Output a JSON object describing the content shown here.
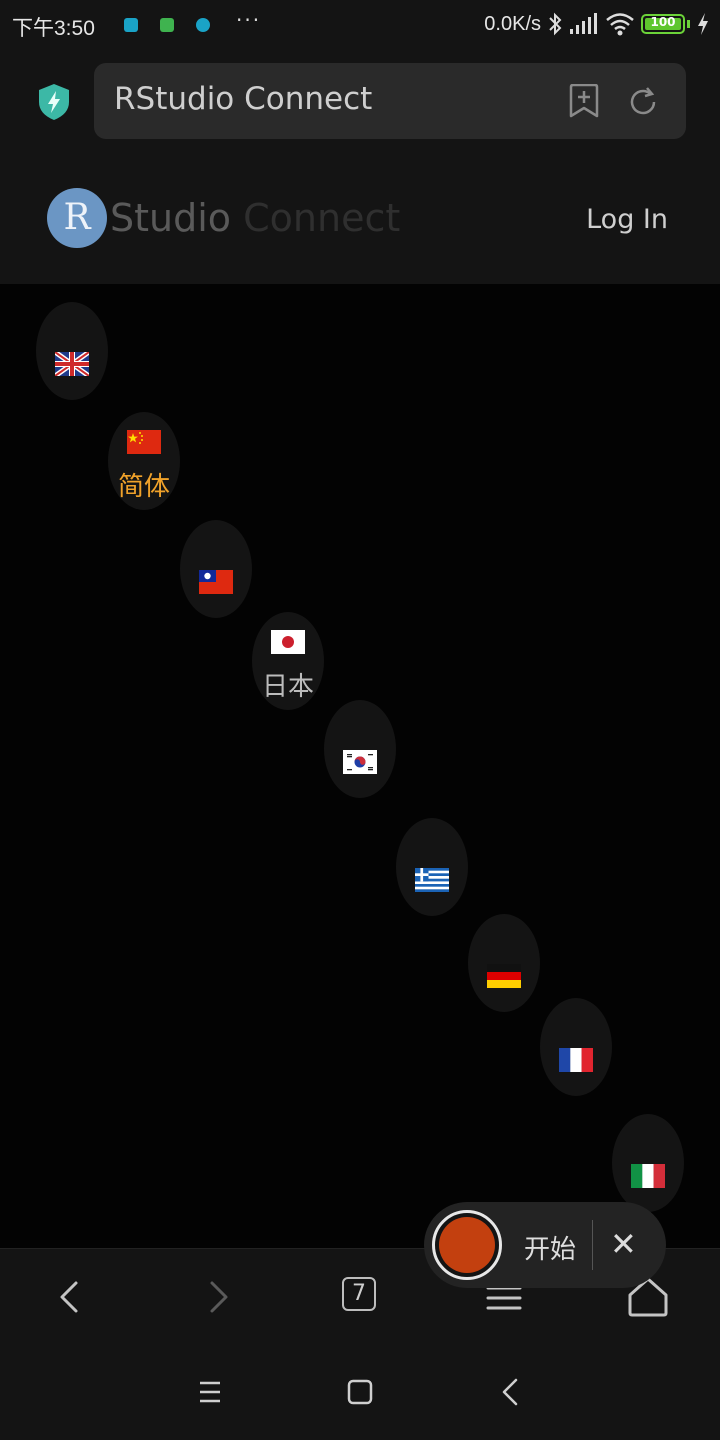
{
  "status_bar": {
    "time": "下午3:50",
    "network_speed": "0.0K/s",
    "battery_percent": "100",
    "battery_level": 1.0,
    "more_indicator": "···",
    "notification_colors": [
      "#1aa3c7",
      "#3fb34f",
      "#1aa3c7"
    ]
  },
  "browser": {
    "url_title": "RStudio Connect",
    "shield_color": "#3cb8a6",
    "tab_count": "7"
  },
  "header": {
    "logo_letter": "R",
    "logo_studio": "Studio",
    "logo_connect": " Connect",
    "login_label": "Log In"
  },
  "languages": [
    {
      "flag": "uk",
      "label": "",
      "active": false
    },
    {
      "flag": "china",
      "label": "简体",
      "active": true
    },
    {
      "flag": "taiwan",
      "label": "",
      "active": false
    },
    {
      "flag": "japan",
      "label": "日本",
      "active": false
    },
    {
      "flag": "korea",
      "label": "",
      "active": false
    },
    {
      "flag": "greece",
      "label": "",
      "active": false
    },
    {
      "flag": "germany",
      "label": "",
      "active": false
    },
    {
      "flag": "france",
      "label": "",
      "active": false
    },
    {
      "flag": "italy",
      "label": "",
      "active": false
    }
  ],
  "recorder": {
    "start_label": "开始",
    "close_symbol": "✕",
    "record_color": "#c3400f"
  }
}
